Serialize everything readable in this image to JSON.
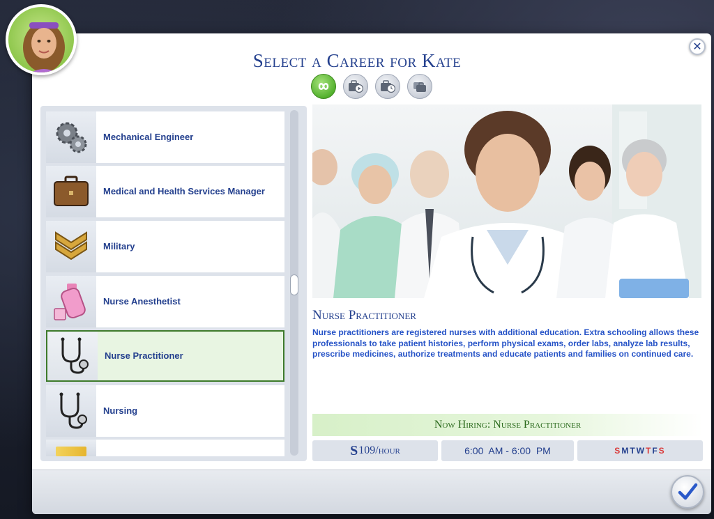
{
  "dialog": {
    "title": "Select a Career for Kate",
    "close_label": "✕"
  },
  "filters": [
    {
      "name": "all-careers-filter",
      "icon": "infinity-icon",
      "active": true
    },
    {
      "name": "full-time-filter",
      "icon": "briefcase-play-icon",
      "active": false
    },
    {
      "name": "part-time-filter",
      "icon": "briefcase-clock-icon",
      "active": false
    },
    {
      "name": "freelance-filter",
      "icon": "briefcase-stack-icon",
      "active": false
    }
  ],
  "careers": [
    {
      "label": "Mechanical Engineer",
      "icon": "gears-icon"
    },
    {
      "label": "Medical and Health Services Manager",
      "icon": "briefcase-icon"
    },
    {
      "label": "Military",
      "icon": "chevron-rank-icon"
    },
    {
      "label": "Nurse Anesthetist",
      "icon": "medicine-bottle-icon"
    },
    {
      "label": "Nurse Practitioner",
      "icon": "stethoscope-icon",
      "selected": true
    },
    {
      "label": "Nursing",
      "icon": "stethoscope-icon"
    }
  ],
  "detail": {
    "title": "Nurse Practitioner",
    "description": "Nurse practitioners are registered nurses with additional education. Extra schooling allows these professionals to take patient histories, perform physical exams, order labs, analyze lab results, prescribe medicines, authorize treatments and educate patients and families on continued care.",
    "hiring": "Now Hiring: Nurse Practitioner",
    "pay_currency": "S",
    "pay_amount": "109/hour",
    "hours": "6:00  AM - 6:00  PM",
    "days": [
      {
        "d": "S",
        "work": true
      },
      {
        "d": "M",
        "work": false
      },
      {
        "d": "T",
        "work": false
      },
      {
        "d": "W",
        "work": false
      },
      {
        "d": "T",
        "work": true
      },
      {
        "d": "F",
        "work": false
      },
      {
        "d": "S",
        "work": true
      }
    ]
  },
  "colors": {
    "accent": "#24408e",
    "selected_border": "#3d7a2a",
    "hiring_text": "#2c6b1e",
    "workday": "#d93a3a"
  }
}
